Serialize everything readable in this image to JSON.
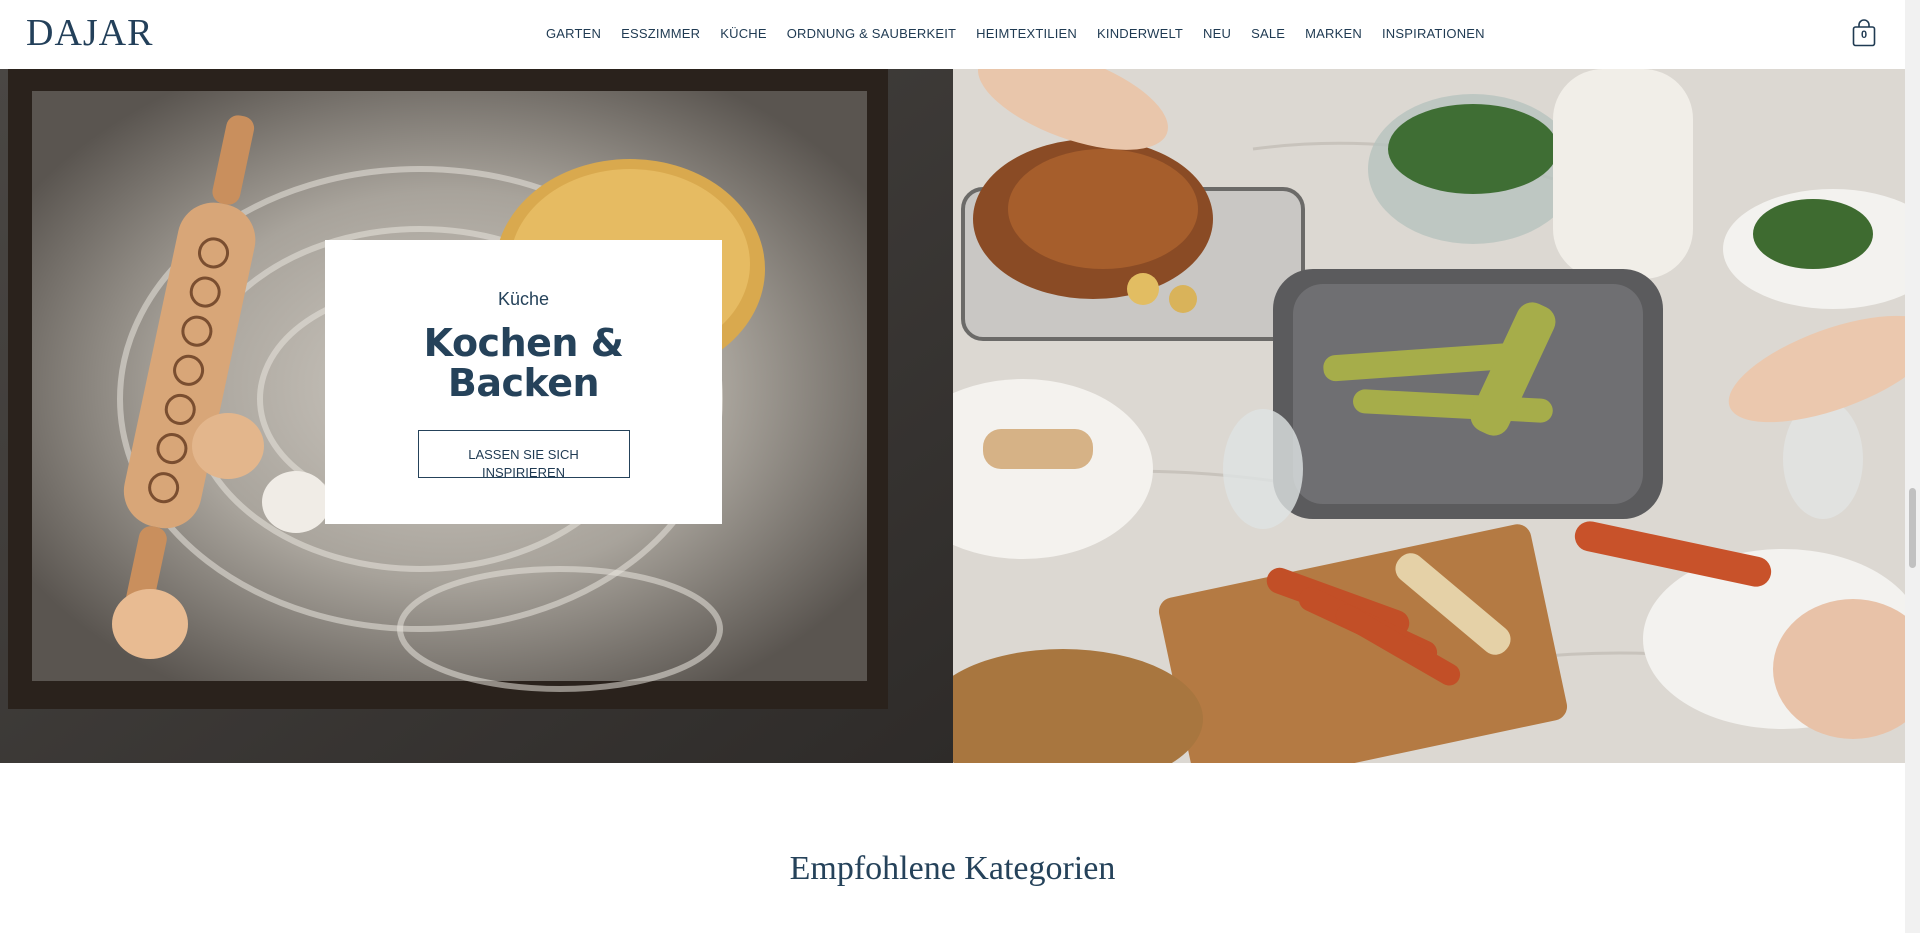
{
  "header": {
    "logo": "DAJAR",
    "nav": [
      "GARTEN",
      "ESSZIMMER",
      "KÜCHE",
      "ORDNUNG & SAUBERKEIT",
      "HEIMTEXTILIEN",
      "KINDERWELT",
      "NEU",
      "SALE",
      "MARKEN",
      "INSPIRATIONEN"
    ],
    "cart_count": "0"
  },
  "hero": {
    "eyebrow": "Küche",
    "title_line1": "Kochen &",
    "title_line2": "Backen",
    "cta": "LASSEN SIE SICH INSPIRIEREN"
  },
  "section": {
    "title": "Empfohlene Kategorien"
  },
  "colors": {
    "primary": "#25425a",
    "background": "#ffffff"
  }
}
